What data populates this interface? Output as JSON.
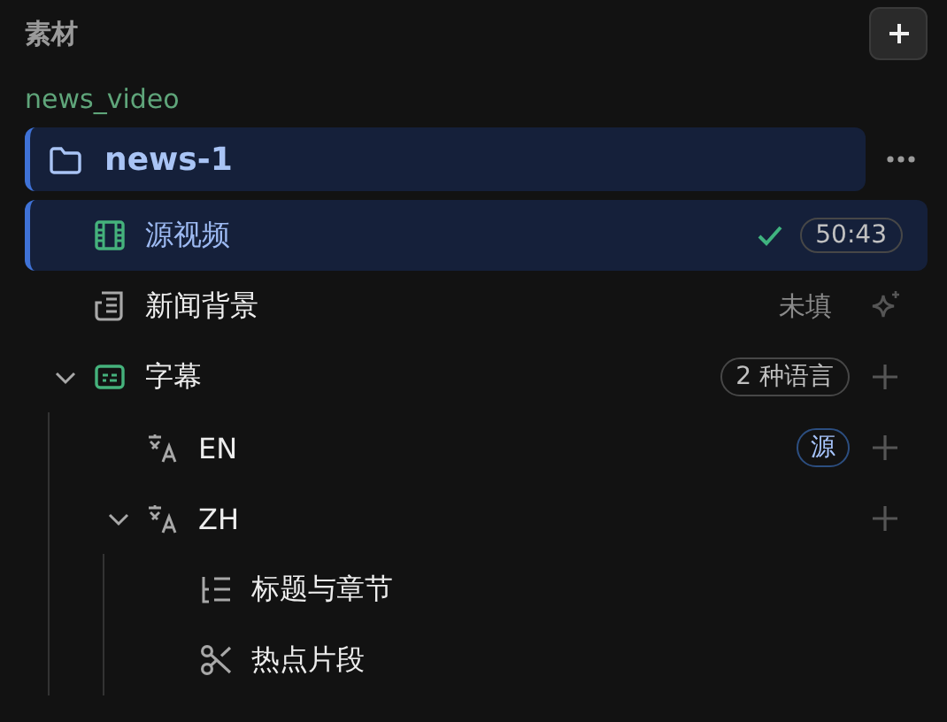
{
  "panel": {
    "title": "素材"
  },
  "project": "news_video",
  "folder": {
    "name": "news-1",
    "selected": true
  },
  "items": [
    {
      "kind": "video",
      "label": "源视频",
      "selected": true,
      "done": true,
      "badge": "50:43"
    },
    {
      "kind": "doc",
      "label": "新闻背景",
      "selected": false,
      "status": "未填"
    },
    {
      "kind": "subtitles",
      "label": "字幕",
      "selected": false,
      "expanded": true,
      "badge": "2 种语言",
      "children": [
        {
          "kind": "language",
          "label": "EN",
          "selected": false,
          "tag": "源"
        },
        {
          "kind": "language",
          "label": "ZH",
          "selected": false,
          "expanded": true,
          "children": [
            {
              "kind": "chapters",
              "label": "标题与章节",
              "selected": false
            },
            {
              "kind": "clips",
              "label": "热点片段",
              "selected": false
            }
          ]
        }
      ]
    }
  ]
}
